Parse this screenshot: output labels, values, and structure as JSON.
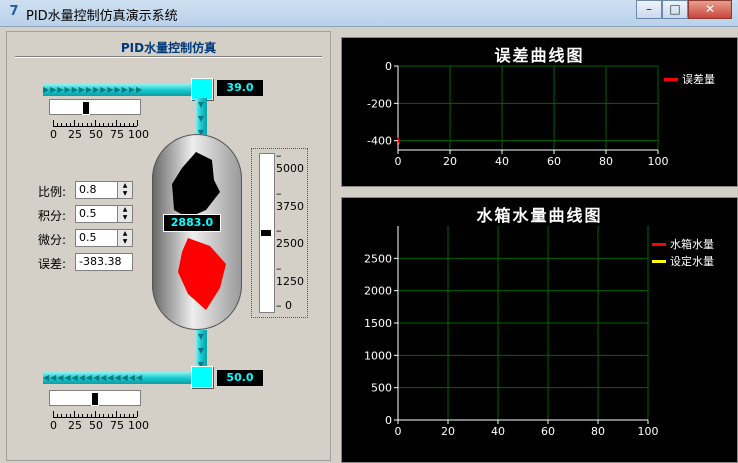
{
  "window": {
    "title": "PID水量控制仿真演示系统",
    "buttons": {
      "minimize": "–",
      "maximize": "□",
      "close": "✕"
    }
  },
  "left_panel": {
    "title": "PID水量控制仿真",
    "inlet": {
      "value_display": "39.0",
      "slider_value": 39
    },
    "outlet": {
      "value_display": "50.0",
      "slider_value": 50
    },
    "slider_ticks": [
      "0",
      "25",
      "50",
      "75",
      "100"
    ],
    "tank": {
      "value_display": "2883.0"
    },
    "gauge": {
      "labels": [
        "5000",
        "3750",
        "2500",
        "1250",
        "0"
      ],
      "value": 2500
    },
    "params": {
      "p_label": "比例:",
      "p_value": "0.8",
      "i_label": "积分:",
      "i_value": "0.5",
      "d_label": "微分:",
      "d_value": "0.5",
      "err_label": "误差:",
      "err_value": "-383.38"
    }
  },
  "charts": {
    "error_chart": {
      "title": "误差曲线图",
      "legend": "误差量",
      "legend_color": "#ff0000"
    },
    "water_chart": {
      "title": "水箱水量曲线图",
      "legend1": "水箱水量",
      "legend1_color": "#ff0000",
      "legend2": "设定水量",
      "legend2_color": "#ffff00"
    }
  },
  "chart_data": [
    {
      "type": "line",
      "title": "误差曲线图",
      "xlim": [
        0,
        100
      ],
      "ylim": [
        -450,
        0
      ],
      "xticks": [
        0,
        20,
        40,
        60,
        80,
        100
      ],
      "yticks": [
        0,
        -200,
        -400
      ],
      "grid": true,
      "legend_position": "right",
      "series": [
        {
          "name": "误差量",
          "x": [
            0,
            0.5
          ],
          "y": [
            -383.38,
            -420
          ]
        }
      ]
    },
    {
      "type": "line",
      "title": "水箱水量曲线图",
      "xlim": [
        0,
        100
      ],
      "ylim": [
        0,
        3000
      ],
      "xticks": [
        0,
        20,
        40,
        60,
        80,
        100
      ],
      "yticks": [
        0,
        500,
        1000,
        1500,
        2000,
        2500
      ],
      "grid": true,
      "legend_position": "right",
      "series": [
        {
          "name": "水箱水量",
          "x": [],
          "y": []
        },
        {
          "name": "设定水量",
          "x": [],
          "y": []
        }
      ]
    }
  ]
}
